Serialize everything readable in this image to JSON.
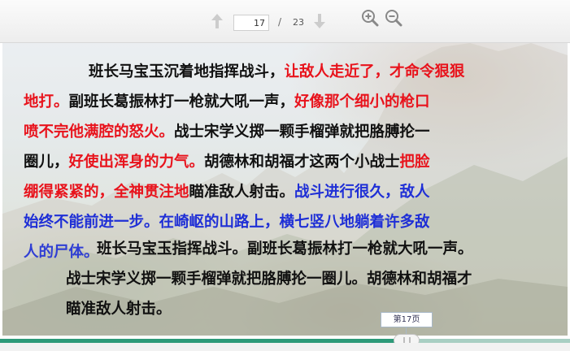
{
  "toolbar": {
    "current_page": "17",
    "separator": "/",
    "total_pages": "23"
  },
  "icons": {
    "prev": "arrow-up-icon",
    "next": "arrow-down-icon",
    "zoom_in": "zoom-in-icon",
    "zoom_out": "zoom-out-icon"
  },
  "slide": {
    "para1": [
      [
        {
          "t": "班长马宝玉沉着地指挥战斗，",
          "c": "black"
        },
        {
          "t": "让敌人走近了，才命令狠狠",
          "c": "red"
        }
      ],
      [
        {
          "t": "地打。",
          "c": "red"
        },
        {
          "t": "副班长葛振林打一枪就大吼一声，",
          "c": "black"
        },
        {
          "t": "好像那个细小的枪口",
          "c": "red"
        }
      ],
      [
        {
          "t": "喷不完他满腔的怒火。",
          "c": "red"
        },
        {
          "t": "战士宋学义掷一颗手榴弹就把胳膊抡一",
          "c": "black"
        }
      ],
      [
        {
          "t": "圈儿，",
          "c": "black"
        },
        {
          "t": "好使出浑身的力气。",
          "c": "red"
        },
        {
          "t": "胡德林和胡福才这两个小战士",
          "c": "black"
        },
        {
          "t": "把脸",
          "c": "red"
        }
      ],
      [
        {
          "t": "绷得紧紧的，全神贯注地",
          "c": "red"
        },
        {
          "t": "瞄准敌人射击。",
          "c": "black"
        },
        {
          "t": "战斗进行很久，敌人",
          "c": "blue"
        }
      ],
      [
        {
          "t": "始终不能前进一步。在崎岖的山路上，横七竖八地躺着许多敌",
          "c": "blue"
        }
      ]
    ],
    "para1_overlap": "人的尸体。",
    "para2": [
      "班长马宝玉指挥战斗。副班长葛振林打一枪就大吼一声。",
      "战士宋学义掷一颗手榴弹就把胳膊抡一圈儿。胡德林和胡福才",
      "瞄准敌人射击。"
    ]
  },
  "progress": {
    "fraction": 0.7,
    "tooltip": "第17页"
  },
  "colors": {
    "red": "#e8131c",
    "blue": "#1f2fd6",
    "progress": "#2d9a79"
  }
}
